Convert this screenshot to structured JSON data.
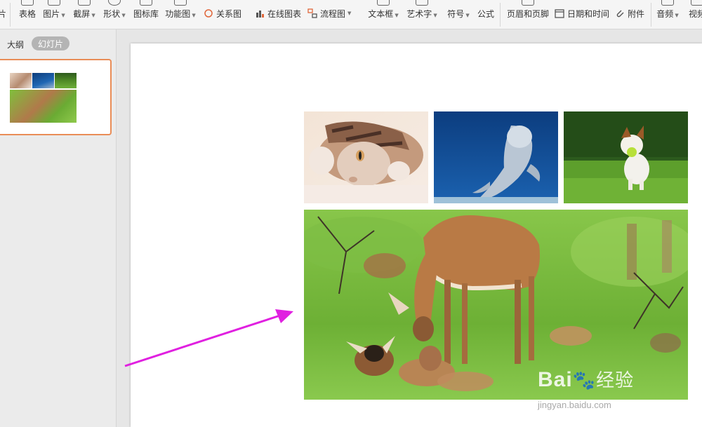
{
  "toolbar": {
    "partial_left": "片",
    "table": "表格",
    "picture": "图片",
    "screenshot": "截屏",
    "shape": "形状",
    "icon_lib": "图标库",
    "function_chart": "功能图",
    "relation": "关系图",
    "online_chart": "在线图表",
    "flowchart": "流程图",
    "textbox": "文本框",
    "wordart": "艺术字",
    "symbol": "符号",
    "formula": "公式",
    "header_footer": "页眉和页脚",
    "date_time": "日期和时间",
    "attachment": "附件",
    "audio": "音频",
    "video": "视频"
  },
  "panel": {
    "outline_tab": "大纲",
    "slides_tab": "幻灯片"
  },
  "watermark": {
    "brand": "Bai",
    "brand_cn": "经验",
    "url": "jingyan.baidu.com"
  },
  "colors": {
    "accent": "#e98d57",
    "arrow": "#e020e0"
  }
}
